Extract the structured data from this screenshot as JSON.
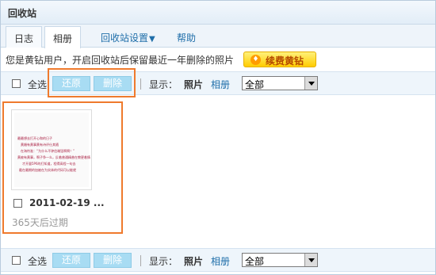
{
  "header": {
    "title": "回收站"
  },
  "tabs": [
    {
      "label": "日志"
    },
    {
      "label": "相册"
    }
  ],
  "tab_links": {
    "settings": "回收站设置",
    "help": "帮助"
  },
  "notice": {
    "text": "您是黄钻用户，开启回收站后保留最近一年删除的照片",
    "vip_button": "续费黄钻"
  },
  "toolbar": {
    "select_all": "全选",
    "restore": "还原",
    "delete": "删除",
    "show_label": "显示：",
    "photo": "照片",
    "album": "相册",
    "filter_value": "全部"
  },
  "items": [
    {
      "date": "2011-02-19 ...",
      "expire": "365天后过期",
      "thumb_lines": [
        "最最想去打开心和的日子",
        "黄婚有黄事黄有诗评仕其随",
        "在海符准：“为什么不钟信端钮啊啊！”",
        "黄被有黄事，啊子争一么，反着普通精普在教更着情",
        "才开量5P6的打知道，程得高程一句去",
        "截在最期的加被在为实体的代码可以能就"
      ]
    }
  ],
  "colors": {
    "highlight": "#ef7a2d",
    "link": "#1f6ea9",
    "button_disabled": "#a8dcf3",
    "vip": "#ffcc00"
  }
}
